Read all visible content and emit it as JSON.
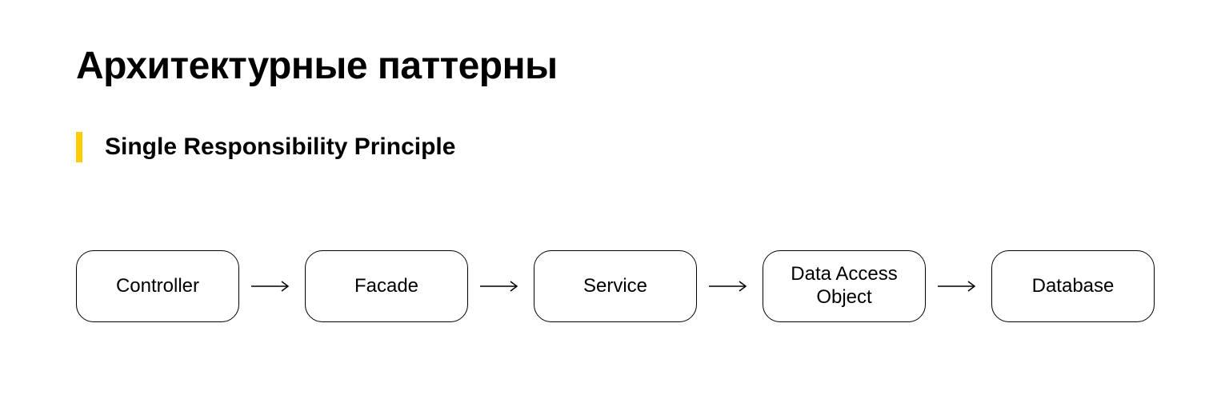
{
  "title": "Архитектурные паттерны",
  "subtitle": "Single Responsibility Principle",
  "accent_color": "#ffcc00",
  "flow": {
    "nodes": [
      "Controller",
      "Facade",
      "Service",
      "Data Access Object",
      "Database"
    ]
  }
}
